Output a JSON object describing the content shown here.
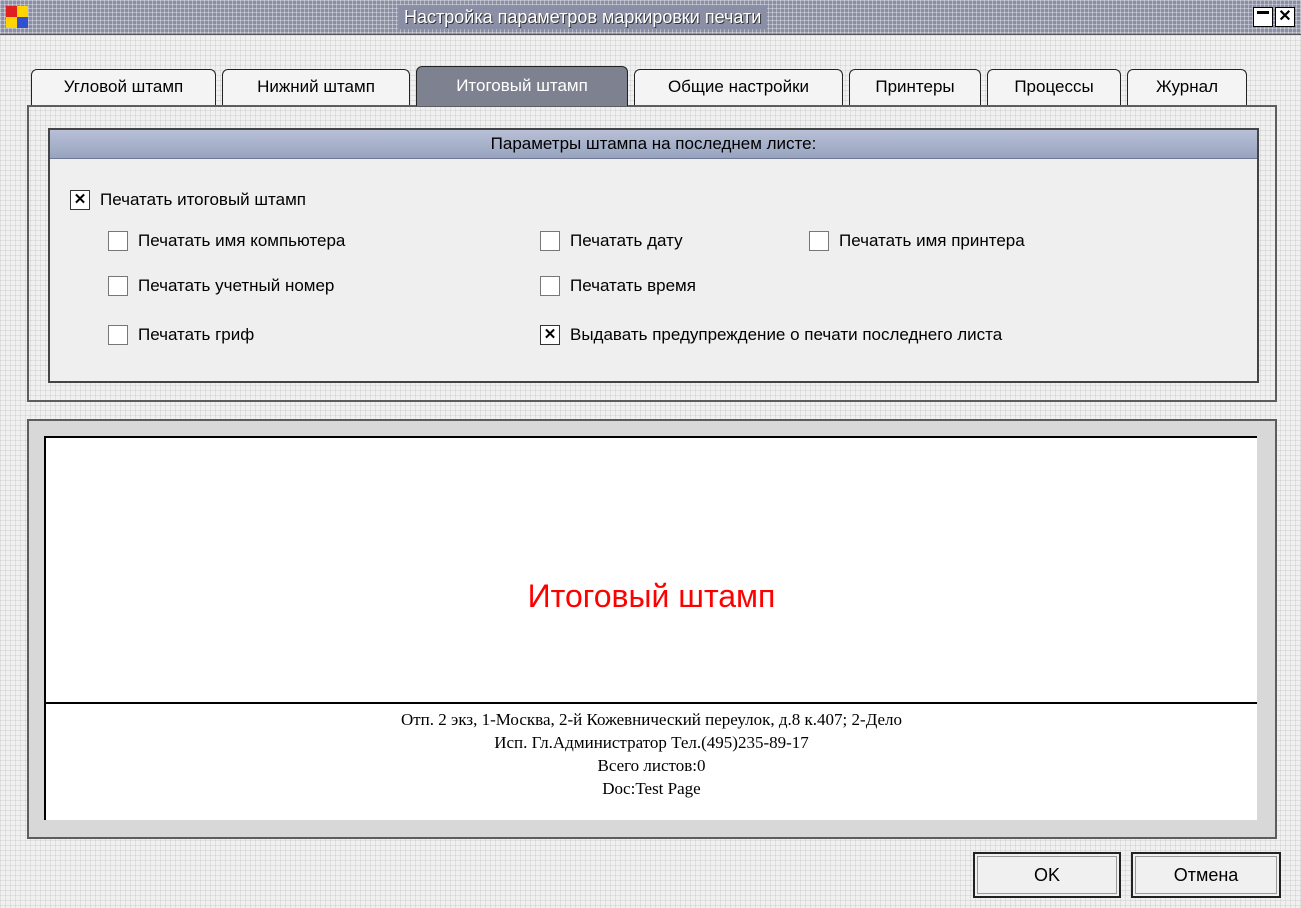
{
  "window": {
    "title": "Настройка параметров маркировки печати",
    "minimize_glyph": "",
    "close_glyph": "✕",
    "colors": {
      "titlebar": "#8a8fa6",
      "active_tab": "#7e8290",
      "preview_title": "#ff0000"
    }
  },
  "tabs": [
    {
      "label": "Угловой штамп",
      "active": false
    },
    {
      "label": "Нижний штамп",
      "active": false
    },
    {
      "label": "Итоговый штамп",
      "active": true
    },
    {
      "label": "Общие настройки",
      "active": false
    },
    {
      "label": "Принтеры",
      "active": false
    },
    {
      "label": "Процессы",
      "active": false
    },
    {
      "label": "Журнал",
      "active": false
    }
  ],
  "group": {
    "header": "Параметры штампа на последнем листе:",
    "checkboxes": {
      "print_final_stamp": {
        "label": "Печатать итоговый штамп",
        "checked": true
      },
      "print_computer_name": {
        "label": "Печатать имя компьютера",
        "checked": false
      },
      "print_account_number": {
        "label": "Печатать учетный номер",
        "checked": false
      },
      "print_classification": {
        "label": "Печатать гриф",
        "checked": false
      },
      "print_date": {
        "label": "Печатать дату",
        "checked": false
      },
      "print_time": {
        "label": "Печатать время",
        "checked": false
      },
      "warn_last_page": {
        "label": "Выдавать предупреждение о печати последнего листа",
        "checked": true
      },
      "print_printer_name": {
        "label": "Печатать имя принтера",
        "checked": false
      }
    },
    "check_glyph": "✕"
  },
  "preview": {
    "title": "Итоговый штамп",
    "lines": [
      "Отп. 2 экз, 1-Москва, 2-й Кожевнический переулок, д.8 к.407; 2-Дело",
      "Исп. Гл.Администратор Тел.(495)235-89-17",
      "Всего листов:0",
      "Doc:Test Page"
    ]
  },
  "buttons": {
    "ok": "OK",
    "cancel": "Отмена"
  }
}
